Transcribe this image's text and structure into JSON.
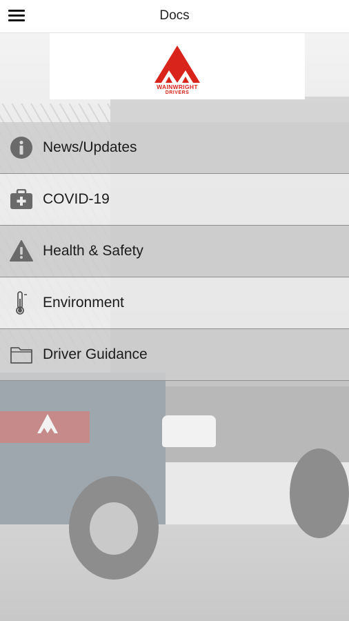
{
  "header": {
    "title": "Docs",
    "menu_icon": "hamburger-menu-icon"
  },
  "brand": {
    "logo_line1": "WAINWRIGHT",
    "logo_line2": "DRIVERS",
    "logo_color": "#d9241b"
  },
  "menu": {
    "items": [
      {
        "label": "News/Updates",
        "icon": "info-icon"
      },
      {
        "label": "COVID-19",
        "icon": "medical-kit-icon"
      },
      {
        "label": "Health & Safety",
        "icon": "warning-icon"
      },
      {
        "label": "Environment",
        "icon": "thermometer-icon"
      },
      {
        "label": "Driver Guidance",
        "icon": "folder-icon"
      }
    ]
  },
  "colors": {
    "row_dark": "#cdcdcd",
    "row_light": "#ececec",
    "icon_gray": "#6a6a6a"
  }
}
